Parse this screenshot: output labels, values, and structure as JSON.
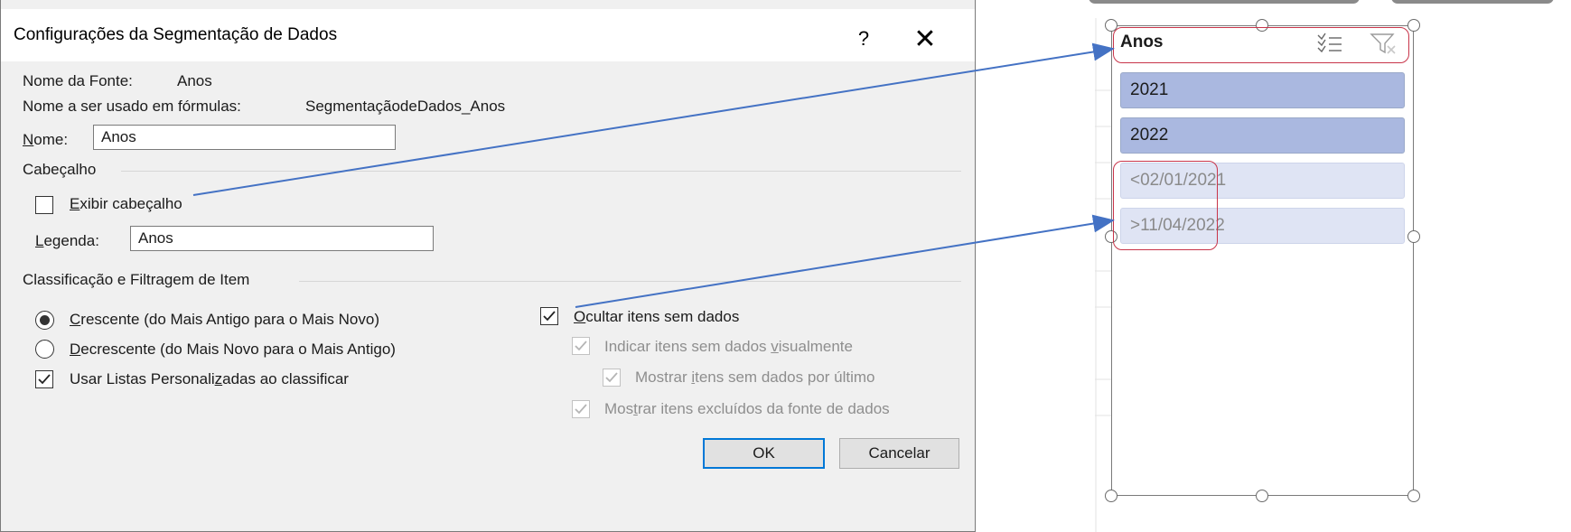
{
  "dialog": {
    "title": "Configurações da Segmentação de Dados",
    "help_label": "?",
    "close_label": "✕",
    "source_name_label": "Nome da Fonte:",
    "source_name_value": "Anos",
    "formula_name_label": "Nome a ser usado em fórmulas:",
    "formula_name_value": "SegmentaçãodeDados_Anos",
    "name_label_mnemonic": "N",
    "name_label_rest": "ome:",
    "name_value": "Anos",
    "header_section": {
      "title": "Cabeçalho",
      "show_header_mnemonic": "E",
      "show_header_rest": "xibir cabeçalho",
      "show_header_checked": false,
      "caption_label_mnemonic": "L",
      "caption_label_rest": "egenda:",
      "caption_value": "Anos"
    },
    "sort_section": {
      "title": "Classificação e Filtragem de Item",
      "ascending_mnemonic": "C",
      "ascending_rest": "rescente (do Mais Antigo para o Mais Novo)",
      "ascending_selected": true,
      "descending_mnemonic": "D",
      "descending_rest": "ecrescente (do Mais Novo para o Mais Antigo)",
      "custom_lists_before": "Usar Listas Personali",
      "custom_lists_mnemonic": "z",
      "custom_lists_after": "adas ao classificar",
      "custom_lists_checked": true,
      "hide_no_data_mnemonic": "O",
      "hide_no_data_rest": "cultar itens sem dados",
      "hide_no_data_checked": true,
      "indicate_no_data_before": "Indicar itens sem dados ",
      "indicate_no_data_mnemonic": "v",
      "indicate_no_data_after": "isualmente",
      "show_no_data_last_before": "Mostrar ",
      "show_no_data_last_mnemonic": "i",
      "show_no_data_last_after": "tens sem dados por último",
      "show_deleted_before": "Mos",
      "show_deleted_mnemonic": "t",
      "show_deleted_after": "rar itens excluídos da fonte de dados"
    },
    "ok_label": "OK",
    "cancel_label": "Cancelar"
  },
  "slicer": {
    "title": "Anos",
    "items": [
      {
        "label": "2021"
      },
      {
        "label": "2022"
      },
      {
        "label": "<02/01/2021"
      },
      {
        "label": ">11/04/2022"
      }
    ]
  },
  "colors": {
    "arrow": "#4472c4",
    "highlight": "#c8354a",
    "slicer_selected": "#aab8e0",
    "slicer_nodata": "#dfe4f4",
    "default_button_border": "#0078d7"
  },
  "icons": [
    "multi-select-icon",
    "clear-filter-icon",
    "help-icon",
    "close-icon",
    "checkmark-icon"
  ]
}
